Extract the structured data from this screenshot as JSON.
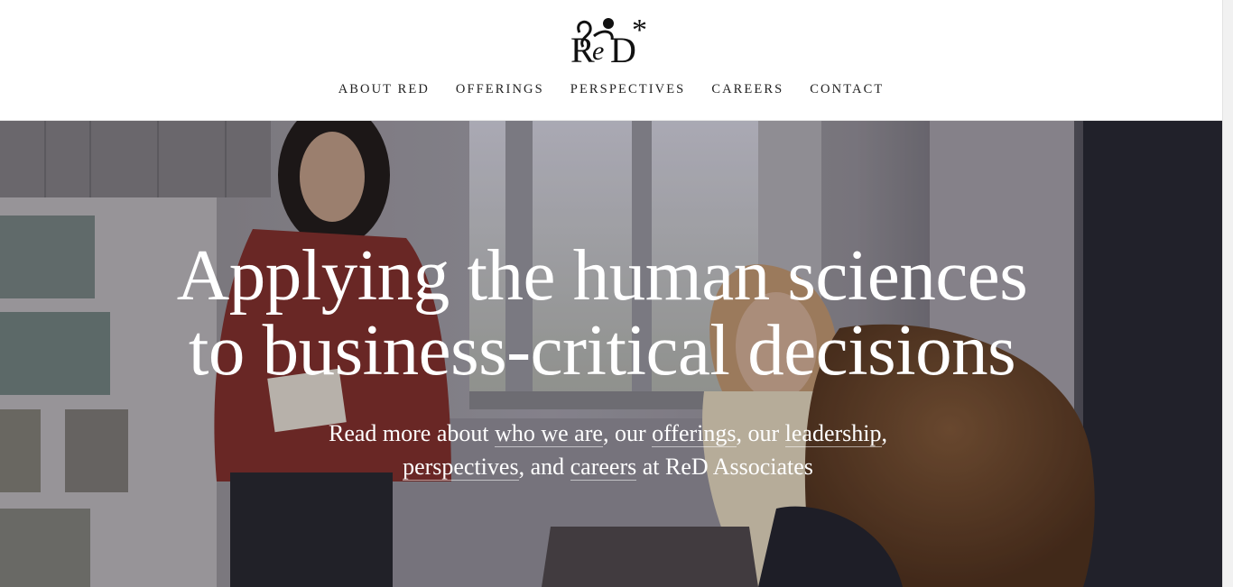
{
  "logo": {
    "text": "ReD*",
    "alt": "ReD Associates logo"
  },
  "nav": {
    "items": [
      {
        "label": "ABOUT RED"
      },
      {
        "label": "OFFERINGS"
      },
      {
        "label": "PERSPECTIVES"
      },
      {
        "label": "CAREERS"
      },
      {
        "label": "CONTACT"
      }
    ]
  },
  "hero": {
    "headline_line1": "Applying the human sciences",
    "headline_line2": "to business-critical decisions",
    "sub": {
      "t1": "Read more about ",
      "link_who": "who we are",
      "t2": ", our ",
      "link_offerings": "offerings",
      "t3": ", our ",
      "link_leadership": "leadership",
      "t4": ",",
      "link_perspectives": "perspectives",
      "t5": ", and ",
      "link_careers": "careers",
      "t6": " at ReD Associates"
    }
  },
  "colors": {
    "header_bg": "#ffffff",
    "nav_text": "#222222",
    "hero_text": "#ffffff"
  },
  "icons": {
    "logo": "red-associates-logo"
  }
}
